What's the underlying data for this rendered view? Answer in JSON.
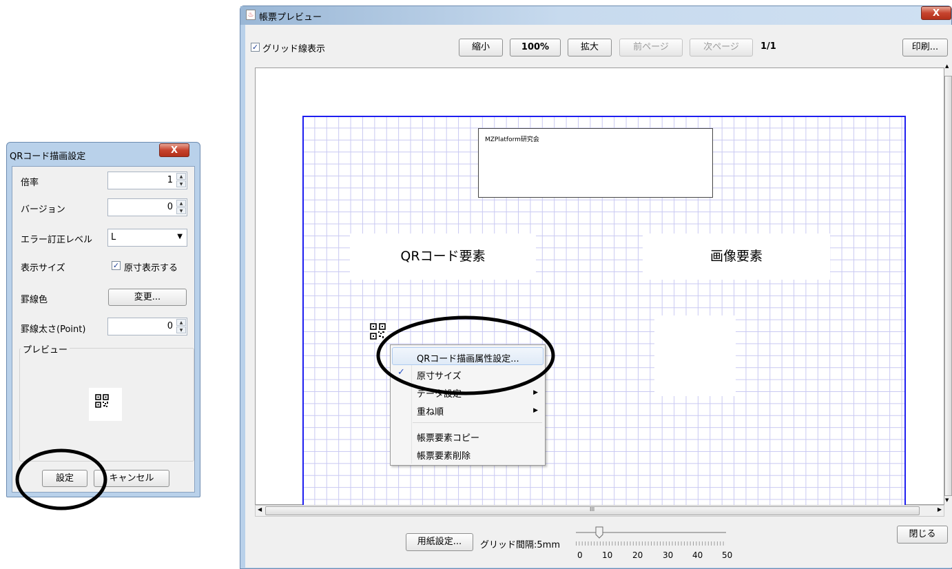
{
  "dialog": {
    "title": "QRコード描画設定",
    "close_label": "X",
    "fields": {
      "scale": {
        "label": "倍率",
        "value": "1"
      },
      "version": {
        "label": "バージョン",
        "value": "0"
      },
      "error_level": {
        "label": "エラー訂正レベル",
        "value": "L"
      },
      "display_size": {
        "label": "表示サイズ",
        "checkbox_label": "原寸表示する",
        "checked": true
      },
      "border_color": {
        "label": "罫線色",
        "button_label": "変更..."
      },
      "border_width": {
        "label": "罫線太さ(Point)",
        "value": "0"
      }
    },
    "preview_label": "プレビュー",
    "ok_label": "設定",
    "cancel_label": "キャンセル"
  },
  "window": {
    "title": "帳票プレビュー",
    "close_label": "X",
    "toolbar": {
      "grid_checkbox_label": "グリッド線表示",
      "grid_checked": true,
      "zoom_out_label": "縮小",
      "zoom_value": "100%",
      "zoom_in_label": "拡大",
      "prev_page_label": "前ページ",
      "next_page_label": "次ページ",
      "page_indicator": "1/1",
      "print_label": "印刷..."
    },
    "canvas": {
      "text_element": "MZPlatform研究会",
      "qr_element_label": "QRコード要素",
      "image_element_label": "画像要素"
    },
    "context_menu": {
      "items": [
        {
          "label": "QRコード描画属性設定...",
          "checked": false,
          "submenu": false
        },
        {
          "label": "原寸サイズ",
          "checked": true,
          "submenu": false
        },
        {
          "label": "データ設定",
          "checked": false,
          "submenu": true
        },
        {
          "label": "重ね順",
          "checked": false,
          "submenu": true
        },
        {
          "label": "帳票要素コピー",
          "checked": false,
          "submenu": false
        },
        {
          "label": "帳票要素削除",
          "checked": false,
          "submenu": false
        }
      ]
    },
    "scroll_marker": "III",
    "footer": {
      "paper_settings_label": "用紙設定...",
      "grid_interval_label": "グリッド間隔:5mm",
      "slider_ticks": [
        "0",
        "10",
        "20",
        "30",
        "40",
        "50"
      ],
      "slider_value": 5,
      "close_label": "閉じる"
    }
  }
}
